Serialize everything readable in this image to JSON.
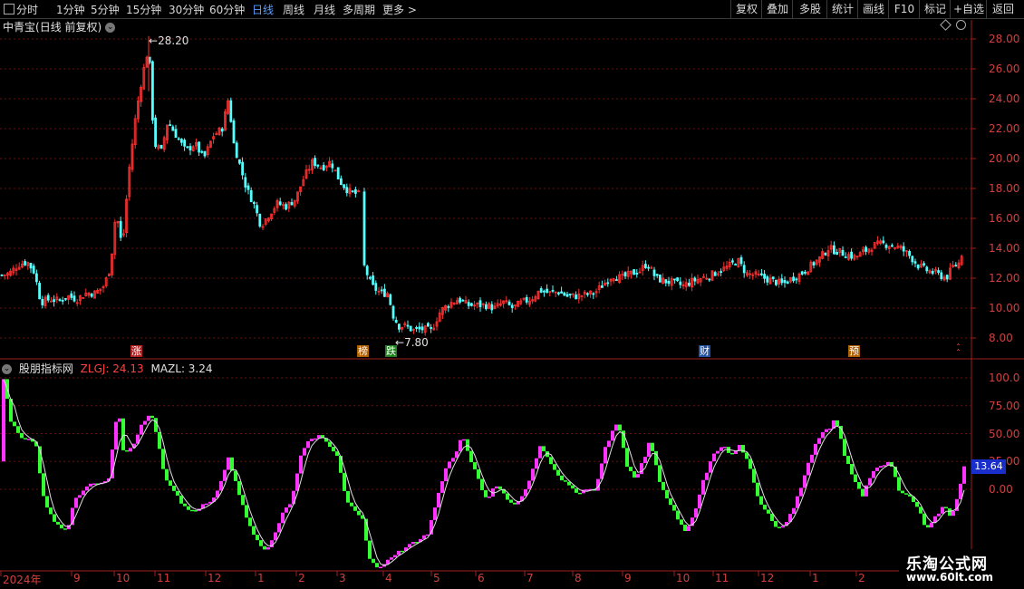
{
  "toolbar": {
    "left_items": [
      "分时",
      "1分钟",
      "5分钟",
      "15分钟",
      "30分钟",
      "60分钟",
      "日线",
      "周线",
      "月线",
      "多周期",
      "更多"
    ],
    "active_item": "日线",
    "right_items": [
      "复权",
      "叠加",
      "多股",
      "统计",
      "画线",
      "F10",
      "标记",
      "+自选",
      "返回"
    ]
  },
  "chart_title": {
    "stock": "中青宝",
    "mode": "(日线 前复权)",
    "collapse_icon": "chevron-down-icon"
  },
  "price_axis": {
    "ticks": [
      "28.00",
      "26.00",
      "24.00",
      "22.00",
      "20.00",
      "18.00",
      "16.00",
      "14.00",
      "12.00",
      "10.00",
      "8.00"
    ]
  },
  "annotations": {
    "high": "28.20",
    "low": "7.80"
  },
  "event_badges": [
    {
      "label": "涨",
      "color": "#b02020"
    },
    {
      "label": "榜",
      "color": "#b06000"
    },
    {
      "label": "跌",
      "color": "#208020"
    },
    {
      "label": "财",
      "color": "#2050a0"
    },
    {
      "label": "预",
      "color": "#b06000"
    }
  ],
  "indicator": {
    "name": "股朋指标网",
    "zlgj_label": "ZLGJ: 24.13",
    "mazl_label": "MAZL: 3.24",
    "axis_ticks": [
      "100.0",
      "75.00",
      "50.00",
      "25.00",
      "0.00"
    ],
    "current_value": "13.64",
    "colors": {
      "up": "#ff33ff",
      "down": "#33ff33",
      "ma": "#e0e0e0",
      "value_box": "#1a2ecc"
    }
  },
  "time_axis": {
    "labels": [
      "2024年",
      "9",
      "10",
      "11",
      "12",
      "1",
      "2",
      "3",
      "4",
      "5",
      "6",
      "7",
      "8",
      "9",
      "10",
      "11",
      "12",
      "1",
      "2"
    ]
  },
  "watermark": {
    "line1": "乐淘公式网",
    "line2": "www.60lt.com"
  },
  "colors": {
    "candle_up": "#ff3030",
    "candle_down": "#54ffff",
    "grid": "#7a1414",
    "axis_text": "#d04040"
  }
}
